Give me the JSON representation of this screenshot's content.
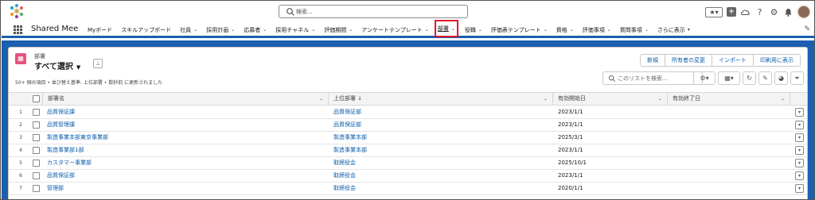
{
  "header": {
    "search_placeholder": "検索...",
    "favorites_star": "★▾",
    "add_icon": "+",
    "help_icon": "?",
    "setup_icon": "⚙",
    "bell_icon": "🔔"
  },
  "nav": {
    "app_name": "Shared Mee",
    "items": [
      {
        "label": "Myボード",
        "chev": ""
      },
      {
        "label": "スキルアップボード",
        "chev": ""
      },
      {
        "label": "社員",
        "chev": "⌄"
      },
      {
        "label": "採用計画",
        "chev": "⌄"
      },
      {
        "label": "応募者",
        "chev": "⌄"
      },
      {
        "label": "採用チャネル",
        "chev": "⌄"
      },
      {
        "label": "評価期間",
        "chev": "⌄"
      },
      {
        "label": "アンケートテンプレート",
        "chev": "⌄"
      },
      {
        "label": "部署",
        "chev": "⌄",
        "selected": true
      },
      {
        "label": "役職",
        "chev": "⌄"
      },
      {
        "label": "評価表テンプレート",
        "chev": "⌄"
      },
      {
        "label": "資格",
        "chev": "⌄"
      },
      {
        "label": "評価事項",
        "chev": "⌄"
      },
      {
        "label": "質問事項",
        "chev": "⌄"
      },
      {
        "label": "さらに表示",
        "chev": "▾"
      }
    ]
  },
  "list": {
    "object_name": "部署",
    "view_name": "すべて選択",
    "view_dropdown": "▼",
    "meta": "50+ 個の項目 • 並び替え基準: 上位部署 • 数秒前 に更新されました",
    "buttons": {
      "new": "新規",
      "change_owner": "所有者の変更",
      "import": "インポート",
      "print": "印刷用に表示"
    },
    "search_placeholder": "このリストを検索...",
    "columns": {
      "name": "部署名",
      "parent": "上位部署 ↓",
      "start": "有効開始日",
      "end": "有効終了日"
    },
    "rows": [
      {
        "num": "1",
        "name": "品質保証課",
        "parent": "品質保証部",
        "start": "2023/1/1",
        "end": ""
      },
      {
        "num": "2",
        "name": "品質管理課",
        "parent": "品質保証部",
        "start": "2023/1/1",
        "end": ""
      },
      {
        "num": "3",
        "name": "製造事業本部東京事業部",
        "parent": "製造事業本部",
        "start": "2025/3/1",
        "end": ""
      },
      {
        "num": "4",
        "name": "製造事業部1部",
        "parent": "製造事業本部",
        "start": "2023/1/1",
        "end": ""
      },
      {
        "num": "5",
        "name": "カスタマー事業部",
        "parent": "取締役会",
        "start": "2025/10/1",
        "end": ""
      },
      {
        "num": "6",
        "name": "品質保証部",
        "parent": "取締役会",
        "start": "2023/1/1",
        "end": ""
      },
      {
        "num": "7",
        "name": "管理部",
        "parent": "取締役会",
        "start": "2020/1/1",
        "end": ""
      }
    ]
  },
  "colors": {
    "brand_blue": "#1b5fb0",
    "link_blue": "#0b5cab",
    "object_icon": "#e3537e",
    "selected_outline": "#e0182d"
  }
}
